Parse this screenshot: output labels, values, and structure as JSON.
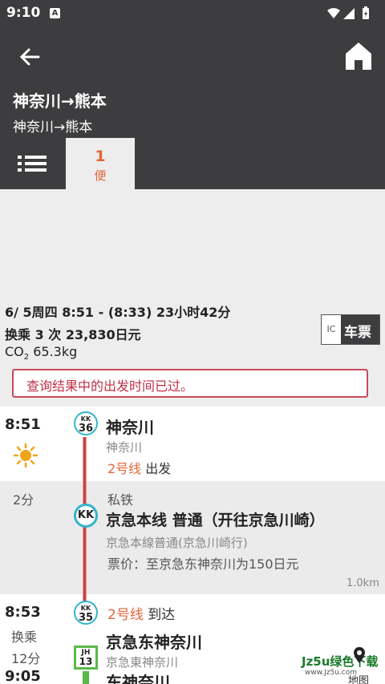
{
  "status": {
    "time": "9:10",
    "notif": "A"
  },
  "header": {
    "title": "神奈川→熊本",
    "subtitle": "神奈川→熊本"
  },
  "tabs": {
    "count": "1",
    "unit": "便"
  },
  "summary": {
    "line1": "6/ 5周四 8:51 - (8:33) 23小时42分",
    "line2": "换乘 3 次 23,830日元",
    "co2_label": "CO",
    "co2_sub": "2",
    "co2_value": " 65.3kg"
  },
  "ticket": {
    "ic": "IC",
    "label": "车票"
  },
  "warning": "查询结果中的出发时间已过。",
  "route": {
    "stop1": {
      "time": "8:51",
      "weather_icon": "sun-icon",
      "badge_line": "KK",
      "badge_num": "36",
      "name": "神奈川",
      "jp": "神奈川",
      "platform": "2号线",
      "action": "出发"
    },
    "leg1": {
      "duration": "2分",
      "type": "私铁",
      "badge": "KK",
      "line_name": "京急本线 普通（开往京急川崎）",
      "jp": "京急本線普通(京急川崎行)",
      "fare": "票价：至京急东神奈川为150日元",
      "distance": "1.0km"
    },
    "stop2": {
      "time": "8:53",
      "transfer": "换乘",
      "transfer_time": "12分",
      "badge_line": "KK",
      "badge_num": "35",
      "platform": "2号线",
      "action": "到达",
      "name": "京急东神奈川",
      "jp": "京急東神奈川"
    },
    "stop3": {
      "time": "9:05",
      "badge_line": "JH",
      "badge_num": "13",
      "name": "东神奈川"
    }
  },
  "watermark": {
    "text": "Jz5u绿色下载",
    "url": "www.Jz5u.com",
    "map": "地图"
  },
  "colors": {
    "header": "#3d3d3f",
    "accent": "#e2663a",
    "rail_red": "#c74444",
    "keikyu_blue": "#33b4cc",
    "jr_green": "#5aba47"
  }
}
